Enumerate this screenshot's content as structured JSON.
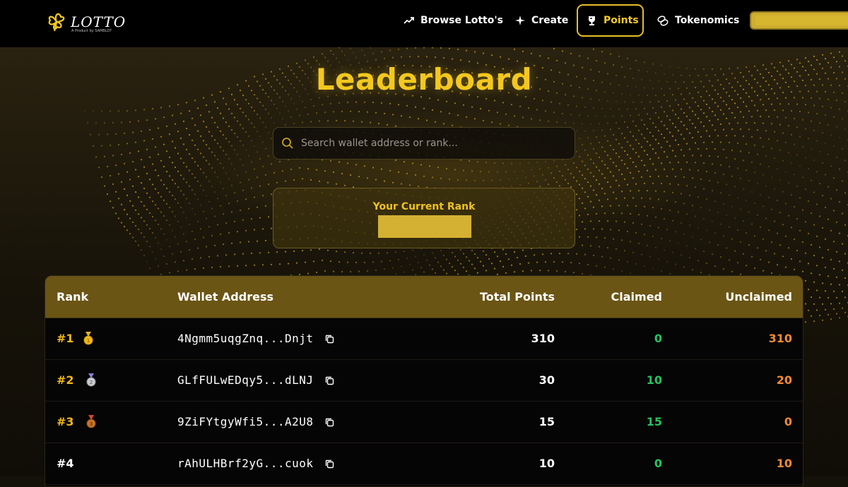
{
  "app": {
    "logo_text": "LOTTO",
    "logo_subtext": "A Product by SAMBLOT"
  },
  "nav": {
    "items": [
      {
        "label": "Browse Lotto's",
        "icon": "trending-up-icon"
      },
      {
        "label": "Create",
        "icon": "sparkle-icon"
      },
      {
        "label": "Points",
        "icon": "trophy-icon",
        "active": true
      },
      {
        "label": "Tokenomics",
        "icon": "coins-icon"
      }
    ]
  },
  "page": {
    "title": "Leaderboard"
  },
  "search": {
    "placeholder": "Search wallet address or rank..."
  },
  "current_rank": {
    "label": "Your Current Rank"
  },
  "table": {
    "headers": {
      "rank": "Rank",
      "wallet": "Wallet Address",
      "total": "Total Points",
      "claimed": "Claimed",
      "unclaimed": "Unclaimed"
    },
    "rows": [
      {
        "rank": "#1",
        "medal": "gold-medal-icon",
        "wallet": "4Ngmm5uqgZnq...Dnjt",
        "total": "310",
        "claimed": "0",
        "unclaimed": "310"
      },
      {
        "rank": "#2",
        "medal": "silver-medal-icon",
        "wallet": "GLfFULwEDqy5...dLNJ",
        "total": "30",
        "claimed": "10",
        "unclaimed": "20"
      },
      {
        "rank": "#3",
        "medal": "bronze-medal-icon",
        "wallet": "9ZiFYtgyWfi5...A2U8",
        "total": "15",
        "claimed": "15",
        "unclaimed": "0"
      },
      {
        "rank": "#4",
        "medal": "",
        "wallet": "rAhULHBrf2yG...cuok",
        "total": "10",
        "claimed": "0",
        "unclaimed": "10"
      }
    ]
  },
  "colors": {
    "accent": "#f3c81e",
    "claimed": "#22c55e",
    "unclaimed": "#f58a32",
    "header_bg": "#6b5515"
  }
}
